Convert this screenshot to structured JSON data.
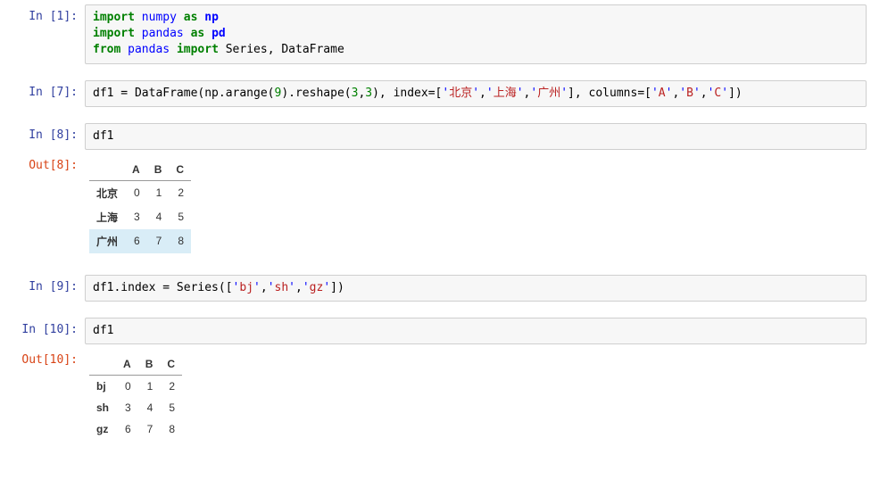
{
  "cells": {
    "in1": {
      "label": "In ",
      "num": "[1]:",
      "code_html": "<span class='kw-green'>import</span> <span class='kw-blue'>numpy</span> <span class='kw-green'>as</span> <span class='kw-nn'>np</span>\n<span class='kw-green'>import</span> <span class='kw-blue'>pandas</span> <span class='kw-green'>as</span> <span class='kw-nn'>pd</span>\n<span class='kw-green'>from</span> <span class='kw-blue'>pandas</span> <span class='kw-green'>import</span> Series, DataFrame"
    },
    "in7": {
      "label": "In ",
      "num": "[7]:",
      "code_html": "df1 = DataFrame(np.arange(<span class='num-green'>9</span>).reshape(<span class='num-green'>3</span>,<span class='num-green'>3</span>), index=[<span class='str-blue'>'</span><span class='str-cjk'>北京</span><span class='str-blue'>'</span>,<span class='str-blue'>'</span><span class='str-cjk'>上海</span><span class='str-blue'>'</span>,<span class='str-blue'>'</span><span class='str-cjk'>广州</span><span class='str-blue'>'</span>], columns=[<span class='str-blue'>'</span><span class='str-red'>A</span><span class='str-blue'>'</span>,<span class='str-blue'>'</span><span class='str-red'>B</span><span class='str-blue'>'</span>,<span class='str-blue'>'</span><span class='str-red'>C</span><span class='str-blue'>'</span>])"
    },
    "in8": {
      "label": "In ",
      "num": "[8]:",
      "code_html": "df1"
    },
    "out8": {
      "label": "Out",
      "num": "[8]:"
    },
    "in9": {
      "label": "In ",
      "num": "[9]:",
      "code_html": "df1.index = Series([<span class='str-blue'>'</span><span class='str-red'>bj</span><span class='str-blue'>'</span>,<span class='str-blue'>'</span><span class='str-red'>sh</span><span class='str-blue'>'</span>,<span class='str-blue'>'</span><span class='str-red'>gz</span><span class='str-blue'>'</span>])"
    },
    "in10": {
      "label": "In ",
      "num": "[10]:",
      "code_html": "df1"
    },
    "out10": {
      "label": "Out",
      "num": "[10]:"
    }
  },
  "tables": {
    "df1a": {
      "columns": [
        "A",
        "B",
        "C"
      ],
      "index": [
        "北京",
        "上海",
        "广州"
      ],
      "rows": [
        [
          0,
          1,
          2
        ],
        [
          3,
          4,
          5
        ],
        [
          6,
          7,
          8
        ]
      ],
      "highlight_row": 2
    },
    "df1b": {
      "columns": [
        "A",
        "B",
        "C"
      ],
      "index": [
        "bj",
        "sh",
        "gz"
      ],
      "rows": [
        [
          0,
          1,
          2
        ],
        [
          3,
          4,
          5
        ],
        [
          6,
          7,
          8
        ]
      ],
      "highlight_row": -1
    }
  }
}
